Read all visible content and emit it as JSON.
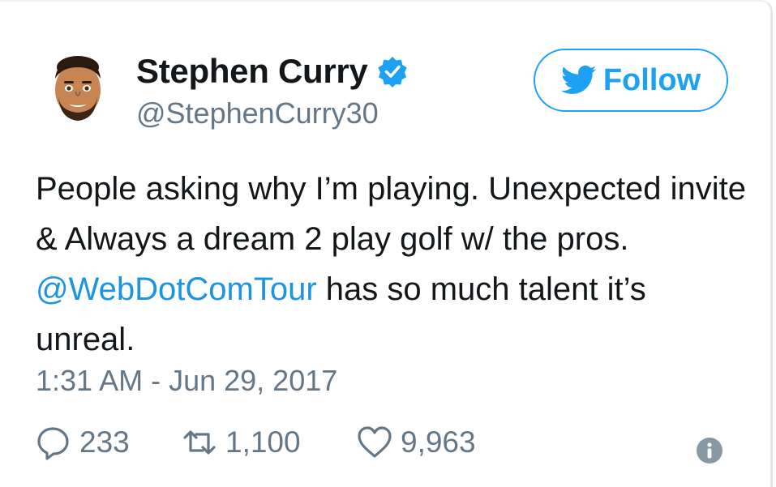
{
  "user": {
    "name": "Stephen Curry",
    "handle": "@StephenCurry30",
    "verified": true
  },
  "follow_button": {
    "label": "Follow"
  },
  "tweet": {
    "text_before": "People asking why I’m playing. Unexpected invite & Always a dream 2 play golf w/ the pros. ",
    "mention": "@WebDotComTour",
    "text_after": " has so much talent it’s unreal.",
    "timestamp": "1:31 AM - Jun 29, 2017"
  },
  "actions": {
    "replies": "233",
    "retweets": "1,100",
    "likes": "9,963"
  },
  "icons": {
    "avatar": "emoji-avatar",
    "verified": "verified-badge-icon",
    "bird": "twitter-bird-icon",
    "reply": "reply-icon",
    "retweet": "retweet-icon",
    "like": "heart-icon",
    "info": "info-icon"
  },
  "colors": {
    "brand_blue": "#1da1f2",
    "link_blue": "#1b95e0",
    "text": "#14171a",
    "secondary": "#657786"
  }
}
